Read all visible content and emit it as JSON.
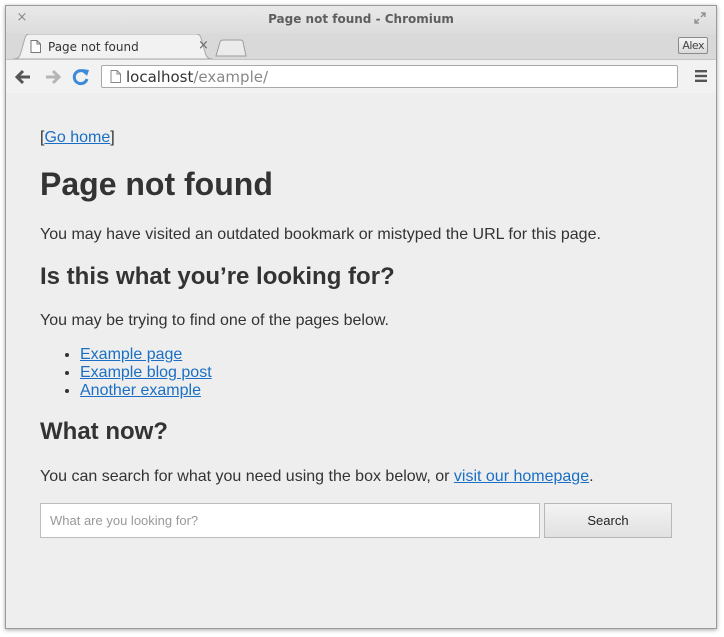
{
  "window": {
    "title": "Page not found - Chromium",
    "close_glyph": "×"
  },
  "tabs": [
    {
      "label": "Page not found",
      "close_glyph": "×",
      "icon": "page-icon"
    }
  ],
  "profile": {
    "name": "Alex"
  },
  "toolbar": {
    "url_host": "localhost",
    "url_path": "/example/",
    "icons": [
      "back-arrow-icon",
      "forward-arrow-icon",
      "reload-icon",
      "page-icon",
      "menu-icon"
    ]
  },
  "page": {
    "breadcrumb": {
      "open": "[",
      "link": "Go home",
      "close": "]"
    },
    "title": "Page not found",
    "intro": "You may have visited an outdated bookmark or mistyped the URL for this page.",
    "suggest_heading": "Is this what you’re looking for?",
    "suggest_text": "You may be trying to find one of the pages below.",
    "suggestions": [
      "Example page",
      "Example blog post",
      "Another example"
    ],
    "what_now_heading": "What now?",
    "what_now_text": "You can search for what you need using the box below, or ",
    "homepage_link": "visit our homepage",
    "what_now_end": ".",
    "search": {
      "placeholder": "What are you looking for?",
      "value": "",
      "button": "Search"
    }
  },
  "colors": {
    "link": "#1a6fc4",
    "text": "#333333",
    "content_bg": "#eeeeee",
    "reload_blue": "#3d8ad8"
  }
}
